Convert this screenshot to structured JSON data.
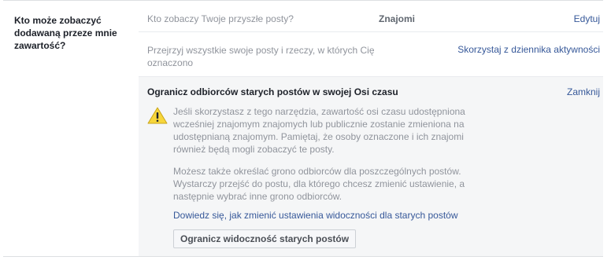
{
  "section": {
    "label": "Kto może zobaczyć dodawaną przeze mnie zawartość?"
  },
  "future_posts": {
    "question": "Kto zobaczy Twoje przyszłe posty?",
    "value": "Znajomi",
    "edit_label": "Edytuj"
  },
  "review": {
    "text": "Przejrzyj wszystkie swoje posty i rzeczy, w których Cię oznaczono",
    "link_label": "Skorzystaj z dziennika aktywności"
  },
  "limit_panel": {
    "title": "Ogranicz odbiorców starych postów w swojej Osi czasu",
    "close_label": "Zamknij",
    "warning_icon": "warning-triangle-icon",
    "paragraph1": "Jeśli skorzystasz z tego narzędzia, zawartość osi czasu udostępniona wcześniej znajomym znajomych lub publicznie zostanie zmieniona na udostępnianą znajomym. Pamiętaj, że osoby oznaczone i ich znajomi również będą mogli zobaczyć te posty.",
    "paragraph2": "Możesz także określać grono odbiorców dla poszczególnych postów. Wystarczy przejść do postu, dla którego chcesz zmienić ustawienie, a następnie wybrać inne grono odbiorców.",
    "learn_link": "Dowiedz się, jak zmienić ustawienia widoczności dla starych postów",
    "button_label": "Ogranicz widoczność starych postów"
  },
  "colors": {
    "link": "#365899",
    "muted_text": "#90949c",
    "panel_bg": "#f5f6f7",
    "warning_yellow": "#f7d63b"
  }
}
